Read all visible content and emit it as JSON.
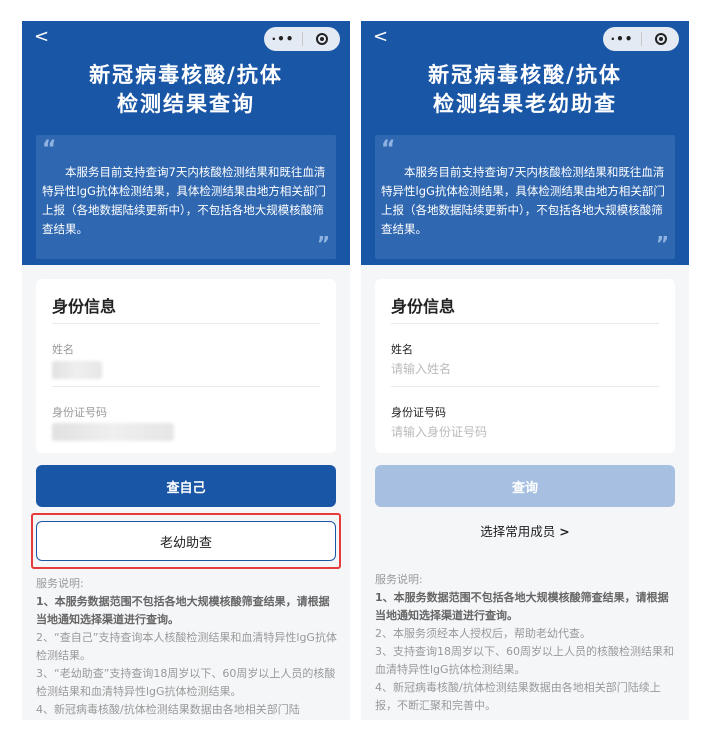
{
  "nav": {
    "back_glyph": "<",
    "capsule_dots": "·••",
    "menu_icon": "more-dots-icon",
    "close_icon": "target-icon"
  },
  "left": {
    "title_line1": "新冠病毒核酸/抗体",
    "title_line2": "检测结果查询",
    "quote_open": "“",
    "quote_close": "”",
    "intro": "本服务目前支持查询7天内核酸检测结果和既往血清特异性lgG抗体检测结果，具体检测结果由地方相关部门上报（各地数据陆续更新中），不包括各地大规模核酸筛查结果。",
    "card_title": "身份信息",
    "name_label": "姓名",
    "id_label": "身份证号码",
    "query_self_button": "查自己",
    "elderly_child_button": "老幼助查",
    "notes_heading": "服务说明:",
    "notes": [
      {
        "text": "1、本服务数据范围不包括各地大规模核酸筛查结果，请根据当地通知选择渠道进行查询。",
        "bold": true
      },
      {
        "text": "2、“查自己”支持查询本人核酸检测结果和血清特异性lgG抗体检测结果。",
        "bold": false
      },
      {
        "text": "3、“老幼助查”支持查询18周岁以下、60周岁以上人员的核酸检测结果和血清特异性lgG抗体检测结果。",
        "bold": false
      },
      {
        "text": "4、新冠病毒核酸/抗体检测结果数据由各地相关部门陆",
        "bold": false
      }
    ]
  },
  "right": {
    "title_line1": "新冠病毒核酸/抗体",
    "title_line2": "检测结果老幼助查",
    "quote_open": "“",
    "quote_close": "”",
    "intro": "本服务目前支持查询7天内核酸检测结果和既往血清特异性lgG抗体检测结果，具体检测结果由地方相关部门上报（各地数据陆续更新中），不包括各地大规模核酸筛查结果。",
    "card_title": "身份信息",
    "name_label": "姓名",
    "name_placeholder": "请输入姓名",
    "id_label": "身份证号码",
    "id_placeholder": "请输入身份证号码",
    "query_button": "查询",
    "select_member_link": "选择常用成员",
    "select_member_chevron": ">",
    "notes_heading": "服务说明:",
    "notes": [
      {
        "text": "1、本服务数据范围不包括各地大规模核酸筛查结果，请根据当地通知选择渠道进行查询。",
        "bold": true
      },
      {
        "text": "2、本服务须经本人授权后，帮助老幼代查。",
        "bold": false
      },
      {
        "text": "3、支持查询18周岁以下、60周岁以上人员的核酸检测结果和血清特异性lgG抗体检测结果。",
        "bold": false
      },
      {
        "text": "4、新冠病毒核酸/抗体检测结果数据由各地相关部门陆续上报，不断汇聚和完善中。",
        "bold": false
      }
    ]
  },
  "colors": {
    "primary": "#1a56a6",
    "primary_disabled": "#a7c0e2",
    "highlight": "#e73a3a",
    "background": "#f5f6f8"
  }
}
